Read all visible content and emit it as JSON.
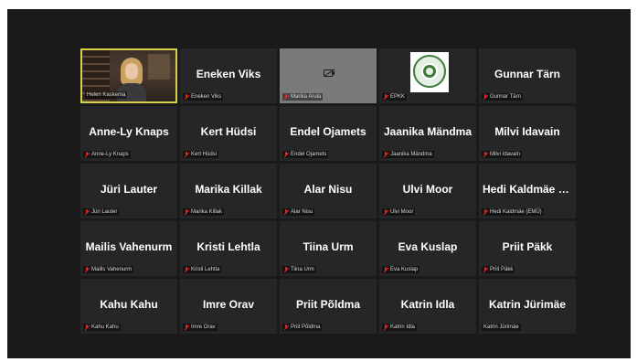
{
  "participants": [
    {
      "type": "video",
      "label": "Helen Kaskema",
      "muted": false
    },
    {
      "type": "name",
      "name": "Eneken Viks",
      "label": "Eneken Viks",
      "muted": true
    },
    {
      "type": "camera-off",
      "label": "Marika Arula",
      "muted": true
    },
    {
      "type": "logo",
      "label": "EPKK",
      "muted": true
    },
    {
      "type": "name",
      "name": "Gunnar Tärn",
      "label": "Gunnar Tärn",
      "muted": true
    },
    {
      "type": "name",
      "name": "Anne-Ly Knaps",
      "label": "Anne-Ly Knaps",
      "muted": true
    },
    {
      "type": "name",
      "name": "Kert Hüdsi",
      "label": "Kert Hüdsi",
      "muted": true
    },
    {
      "type": "name",
      "name": "Endel Ojamets",
      "label": "Endel Ojamets",
      "muted": true
    },
    {
      "type": "name",
      "name": "Jaanika Mändma",
      "label": "Jaanika Mändma",
      "muted": true
    },
    {
      "type": "name",
      "name": "Milvi Idavain",
      "label": "Milvi Idavain",
      "muted": true
    },
    {
      "type": "name",
      "name": "Jüri Lauter",
      "label": "Jüri Lauter",
      "muted": true
    },
    {
      "type": "name",
      "name": "Marika Killak",
      "label": "Marika Killak",
      "muted": true
    },
    {
      "type": "name",
      "name": "Alar Nisu",
      "label": "Alar Nisu",
      "muted": true
    },
    {
      "type": "name",
      "name": "Ulvi Moor",
      "label": "Ulvi Moor",
      "muted": true
    },
    {
      "type": "name",
      "name": "Hedi Kaldmäe  (…",
      "label": "Hedi Kaldmäe  (EMÜ)",
      "muted": true
    },
    {
      "type": "name",
      "name": "Mailis Vahenurm",
      "label": "Mailis Vahenurm",
      "muted": true
    },
    {
      "type": "name",
      "name": "Kristi Lehtla",
      "label": "Kristi Lehtla",
      "muted": true
    },
    {
      "type": "name",
      "name": "Tiina Urm",
      "label": "Tiina Urm",
      "muted": true
    },
    {
      "type": "name",
      "name": "Eva Kuslap",
      "label": "Eva Kuslap",
      "muted": true
    },
    {
      "type": "name",
      "name": "Priit Päkk",
      "label": "Priit Päkk",
      "muted": true
    },
    {
      "type": "name",
      "name": "Kahu Kahu",
      "label": "Kahu Kahu",
      "muted": true
    },
    {
      "type": "name",
      "name": "Imre Orav",
      "label": "Imre Orav",
      "muted": true
    },
    {
      "type": "name",
      "name": "Priit Põldma",
      "label": "Priit Põldma",
      "muted": true
    },
    {
      "type": "name",
      "name": "Katrin Idla",
      "label": "Katrin Idla",
      "muted": true
    },
    {
      "type": "name",
      "name": "Katrin Jürimäe",
      "label": "Katrin Jürimäe",
      "muted": false
    }
  ],
  "colors": {
    "background": "#1a1a1a",
    "tile": "#262626",
    "active_speaker_border": "#d6d24a",
    "muted_icon": "#e02828"
  },
  "icons": {
    "muted": "microphone-muted-icon",
    "camera_off": "camera-off-icon"
  }
}
